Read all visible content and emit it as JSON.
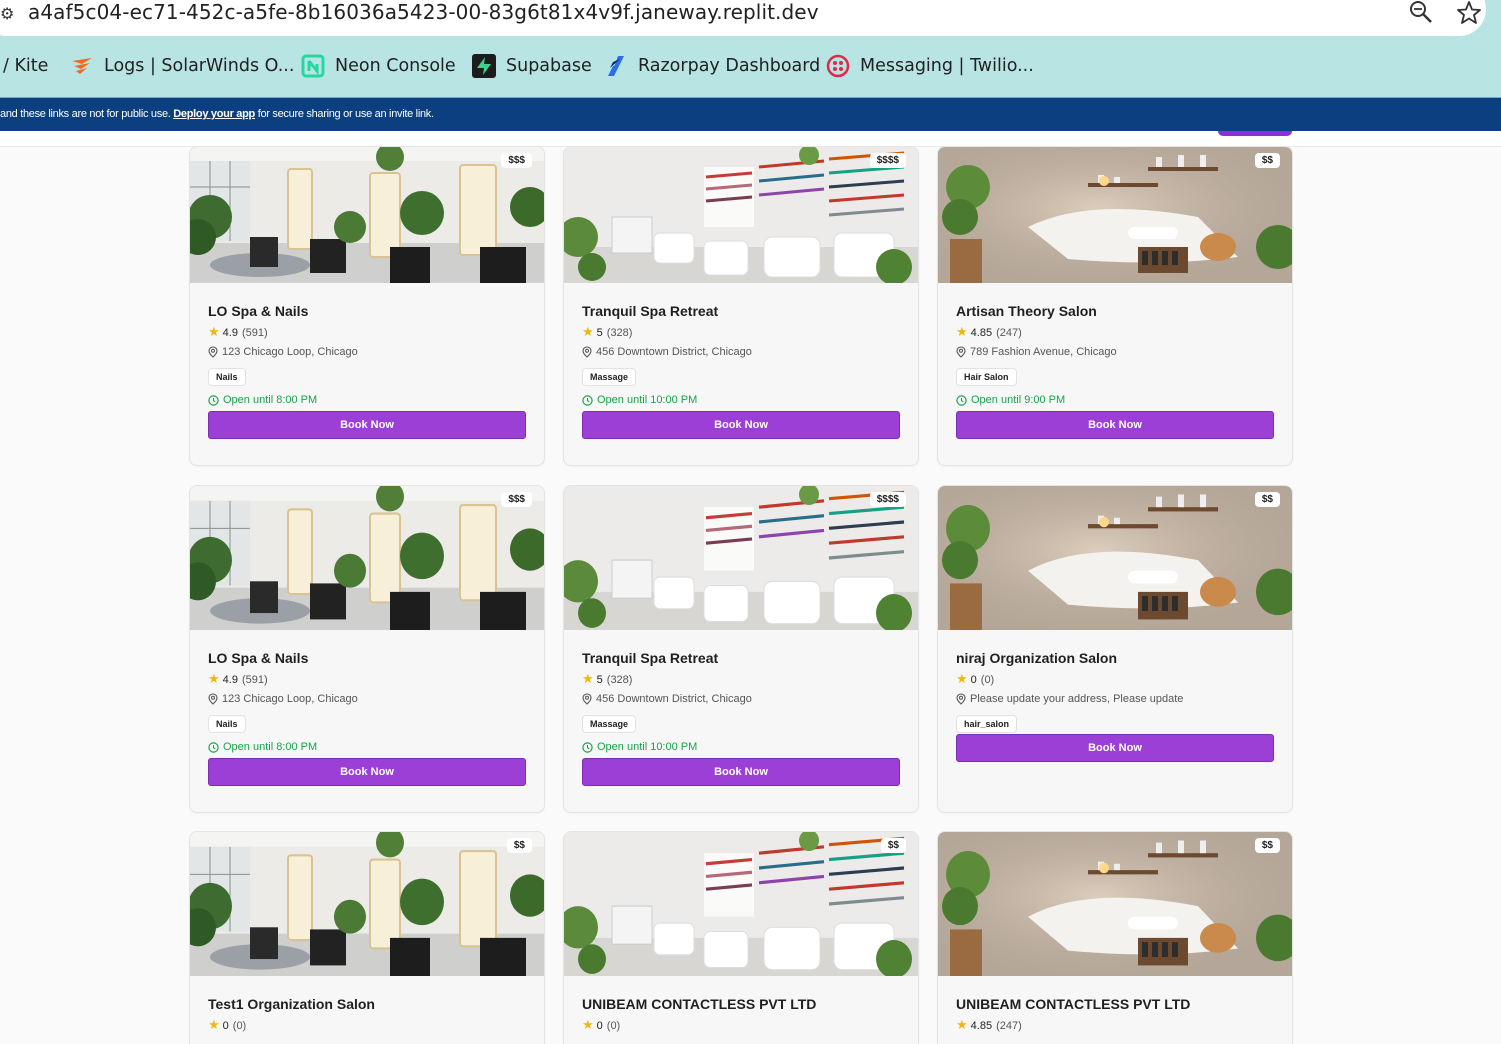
{
  "browser": {
    "url": "a4af5c04-ec71-452c-a5fe-8b16036a5423-00-83g6t81x4v9f.janeway.replit.dev",
    "bookmarks": [
      {
        "label": "/ Kite",
        "icon": "none"
      },
      {
        "label": "Logs | SolarWinds O...",
        "icon": "solarwinds-icon"
      },
      {
        "label": "Neon Console",
        "icon": "neon-icon"
      },
      {
        "label": "Supabase",
        "icon": "supabase-icon"
      },
      {
        "label": "Razorpay Dashboard",
        "icon": "razorpay-icon"
      },
      {
        "label": "Messaging | Twilio...",
        "icon": "twilio-icon"
      }
    ]
  },
  "banner": {
    "prefix": "and these links are not for public use. ",
    "link": "Deploy your app",
    "suffix": " for secure sharing or use an invite link."
  },
  "cards": [
    {
      "title": "LO Spa & Nails",
      "price": "$$$",
      "rating": "4.9",
      "count": "(591)",
      "address": "123 Chicago Loop, Chicago",
      "tag": "Nails",
      "hours": "Open until 8:00 PM",
      "button": "Book Now",
      "image": "salon"
    },
    {
      "title": "Tranquil Spa Retreat",
      "price": "$$$$",
      "rating": "5",
      "count": "(328)",
      "address": "456 Downtown District, Chicago",
      "tag": "Massage",
      "hours": "Open until 10:00 PM",
      "button": "Book Now",
      "image": "nails"
    },
    {
      "title": "Artisan Theory Salon",
      "price": "$$",
      "rating": "4.85",
      "count": "(247)",
      "address": "789 Fashion Avenue, Chicago",
      "tag": "Hair Salon",
      "hours": "Open until 9:00 PM",
      "button": "Book Now",
      "image": "massage"
    },
    {
      "title": "LO Spa & Nails",
      "price": "$$$",
      "rating": "4.9",
      "count": "(591)",
      "address": "123 Chicago Loop, Chicago",
      "tag": "Nails",
      "hours": "Open until 8:00 PM",
      "button": "Book Now",
      "image": "salon"
    },
    {
      "title": "Tranquil Spa Retreat",
      "price": "$$$$",
      "rating": "5",
      "count": "(328)",
      "address": "456 Downtown District, Chicago",
      "tag": "Massage",
      "hours": "Open until 10:00 PM",
      "button": "Book Now",
      "image": "nails"
    },
    {
      "title": "niraj Organization Salon",
      "price": "$$",
      "rating": "0",
      "count": "(0)",
      "address": "Please update your address, Please update",
      "tag": "hair_salon",
      "hours": "",
      "button": "Book Now",
      "image": "massage"
    },
    {
      "title": "Test1 Organization Salon",
      "price": "$$",
      "rating": "0",
      "count": "(0)",
      "address": "",
      "tag": "",
      "hours": "",
      "button": "",
      "image": "salon"
    },
    {
      "title": "UNIBEAM CONTACTLESS PVT LTD",
      "price": "$$",
      "rating": "0",
      "count": "(0)",
      "address": "",
      "tag": "",
      "hours": "",
      "button": "",
      "image": "nails"
    },
    {
      "title": "UNIBEAM CONTACTLESS PVT LTD",
      "price": "$$",
      "rating": "4.85",
      "count": "(247)",
      "address": "",
      "tag": "",
      "hours": "",
      "button": "",
      "image": "massage"
    }
  ],
  "colors": {
    "accent": "#9b3fd6",
    "open": "#17a34a",
    "star": "#f5b50a",
    "banner": "#0b3f7f",
    "chrome": "#b9e4e4"
  }
}
